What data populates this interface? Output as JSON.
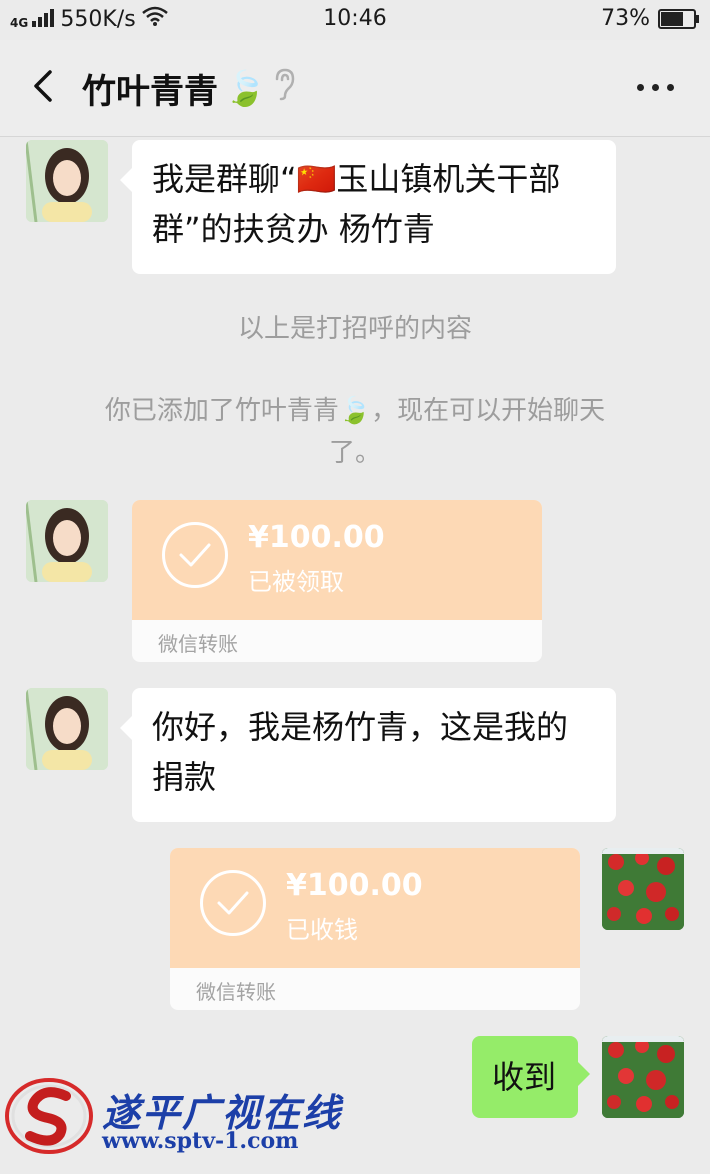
{
  "status_bar": {
    "network": "4G",
    "speed": "550K/s",
    "time": "10:46",
    "battery": "73%",
    "battery_level": 0.73
  },
  "header": {
    "title": "竹叶青青",
    "title_emoji": "🍃"
  },
  "messages": {
    "greeting_line1": "我是群聊“🇨🇳玉山镇机关干部",
    "greeting_line2": "群”的扶贫办 杨竹青",
    "system_greeting": "以上是打招呼的内容",
    "system_added_line1": "你已添加了竹叶青青🍃，现在可以开始聊天",
    "system_added_line2": "了。",
    "transfer1": {
      "amount": "¥100.00",
      "status": "已被领取",
      "label": "微信转账"
    },
    "hello_line1": "你好，我是杨竹青，这是我的",
    "hello_line2": "捐款",
    "transfer2": {
      "amount": "¥100.00",
      "status": "已收钱",
      "label": "微信转账"
    },
    "received": "收到"
  },
  "watermark": {
    "name": "遂平广视在线",
    "url": "www.sptv-1.com"
  },
  "colors": {
    "transfer": "#fdd9b5",
    "sent_bubble": "#95ec69",
    "watermark": "#1c3fa8"
  }
}
